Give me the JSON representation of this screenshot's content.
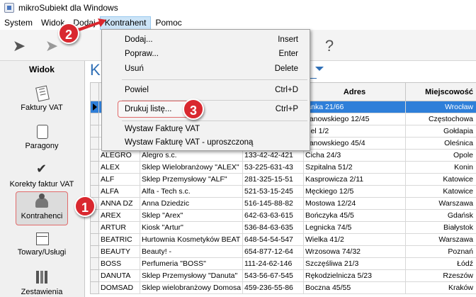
{
  "window": {
    "title": "mikroSubiekt dla Windows"
  },
  "menu": [
    "System",
    "Widok",
    "Dodaj",
    "Kontrahent",
    "Pomoc"
  ],
  "sidebar": {
    "heading": "Widok",
    "items": [
      {
        "label": "Faktury VAT",
        "icon": "invoice-icon"
      },
      {
        "label": "Paragony",
        "icon": "receipt-icon"
      },
      {
        "label": "Korekty faktur VAT",
        "icon": "correction-icon"
      },
      {
        "label": "Kontrahenci",
        "icon": "contractors-icon"
      },
      {
        "label": "Towary/Usługi",
        "icon": "goods-icon"
      },
      {
        "label": "Zestawienia",
        "icon": "reports-icon"
      }
    ]
  },
  "content": {
    "heading_fragment": "K"
  },
  "dropdown": {
    "items": [
      {
        "label": "Dodaj...",
        "shortcut": "Insert"
      },
      {
        "label": "Popraw...",
        "shortcut": "Enter"
      },
      {
        "label": "Usuń",
        "shortcut": "Delete"
      },
      {
        "label": "Powiel",
        "shortcut": "Ctrl+D"
      },
      {
        "label": "Drukuj listę...",
        "shortcut": "Ctrl+P"
      },
      {
        "label": "Wystaw Fakturę VAT",
        "shortcut": ""
      },
      {
        "label": "Wystaw Fakturę VAT - uproszczoną",
        "shortcut": ""
      }
    ]
  },
  "table": {
    "columns": [
      "",
      "",
      "",
      "Adres",
      "Miejscowość"
    ],
    "rows": [
      [
        "",
        "",
        "",
        "lanka 21/66",
        "Wrocław"
      ],
      [
        "",
        "",
        "",
        "nanowskiego 12/45",
        "Częstochowa"
      ],
      [
        "",
        "",
        "",
        "kiel 1/2",
        "Gołdapia"
      ],
      [
        "",
        "",
        "",
        "nanowskiego 45/4",
        "Oleśnica"
      ],
      [
        "ALEGRO",
        "Alegro s.c.",
        "133-42-42-421",
        "Cicha 24/3",
        "Opole"
      ],
      [
        "ALEX",
        "Sklep Wielobranżowy \"ALEX\"",
        "53-225-631-43",
        "Szpitalna 51/2",
        "Konin"
      ],
      [
        "ALF",
        "Sklep Przemysłowy \"ALF\"",
        "281-325-15-51",
        "Kasprowicza 2/11",
        "Katowice"
      ],
      [
        "ALFA",
        "Alfa - Tech s.c.",
        "521-53-15-245",
        "Męckiego 12/5",
        "Katowice"
      ],
      [
        "ANNA DZ",
        "Anna Dziedzic",
        "516-145-88-82",
        "Mostowa 12/24",
        "Warszawa"
      ],
      [
        "AREX",
        "Sklep \"Arex\"",
        "642-63-63-615",
        "Bończyka 45/5",
        "Gdańsk"
      ],
      [
        "ARTUR",
        "Kiosk \"Artur\"",
        "536-84-63-635",
        "Legnicka 74/5",
        "Białystok"
      ],
      [
        "BEATRIC",
        "Hurtownia Kosmetyków BEAT",
        "648-54-54-547",
        "Wielka 41/2",
        "Warszawa"
      ],
      [
        "BEAUTY",
        "Beauty! -",
        "654-877-12-64",
        "Wrzosowa 74/32",
        "Poznań"
      ],
      [
        "BOSS",
        "Perfumeria \"BOSS\"",
        "111-24-62-146",
        "Szczęśliwa 21/3",
        "Łódź"
      ],
      [
        "DANUTA",
        "Sklep Przemysłowy \"Danuta\"",
        "543-56-67-545",
        "Rękodzielnicza 5/23",
        "Rzeszów"
      ],
      [
        "DOMSAD",
        "Sklep wielobranżowy Domosa",
        "459-236-55-86",
        "Boczna 45/55",
        "Kraków"
      ]
    ]
  },
  "badges": [
    "1",
    "2",
    "3"
  ],
  "colors": {
    "selection": "#2f7fd9",
    "badge": "#d9282f",
    "accent": "#2f6fb6"
  }
}
